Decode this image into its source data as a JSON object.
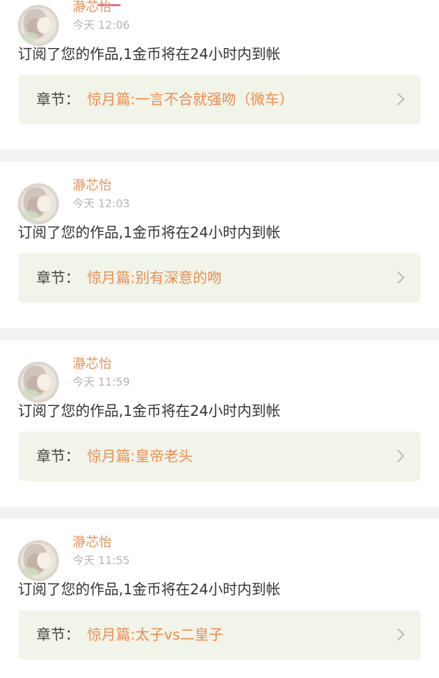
{
  "notifications": [
    {
      "username": "瀞芯怡",
      "time": "今天 12:06",
      "message": "订阅了您的作品,1金币将在24小时内到帐",
      "chapter_label": "章节：",
      "chapter_title": "惊月篇:一言不合就强吻（微车）"
    },
    {
      "username": "瀞芯怡",
      "time": "今天 12:03",
      "message": "订阅了您的作品,1金币将在24小时内到帐",
      "chapter_label": "章节：",
      "chapter_title": "惊月篇:别有深意的吻"
    },
    {
      "username": "瀞芯怡",
      "time": "今天 11:59",
      "message": "订阅了您的作品,1金币将在24小时内到帐",
      "chapter_label": "章节：",
      "chapter_title": "惊月篇:皇帝老头"
    },
    {
      "username": "瀞芯怡",
      "time": "今天 11:55",
      "message": "订阅了您的作品,1金币将在24小时内到帐",
      "chapter_label": "章节：",
      "chapter_title": "惊月篇:太子vs二皇子"
    }
  ],
  "colors": {
    "accent": "#ee8d4f",
    "username": "#e8955c",
    "chapter_bg": "#f1f4e8",
    "separator": "#f2f2f2"
  },
  "icons": {
    "avatar": "avatar-illustration",
    "chevron": "chevron-right-icon"
  }
}
